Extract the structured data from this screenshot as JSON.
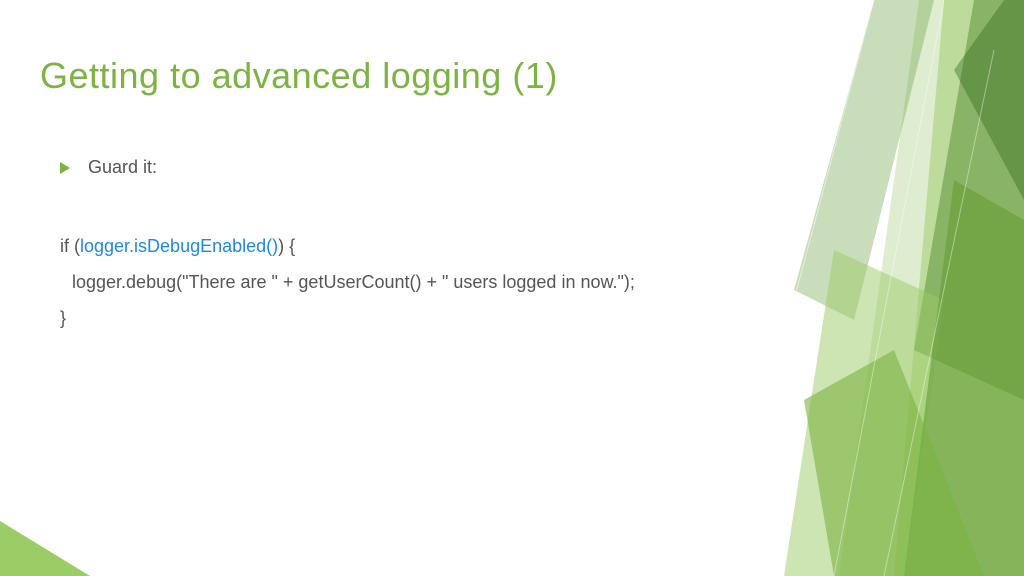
{
  "title": "Getting to advanced logging (1)",
  "bullet": {
    "text": "Guard it:"
  },
  "code": {
    "line1_pre": "if (",
    "line1_highlight": "logger.isDebugEnabled()",
    "line1_post": ") {",
    "line2": "logger.debug(\"There are \" + getUserCount() + \" users logged in now.\");",
    "line3": "}"
  }
}
